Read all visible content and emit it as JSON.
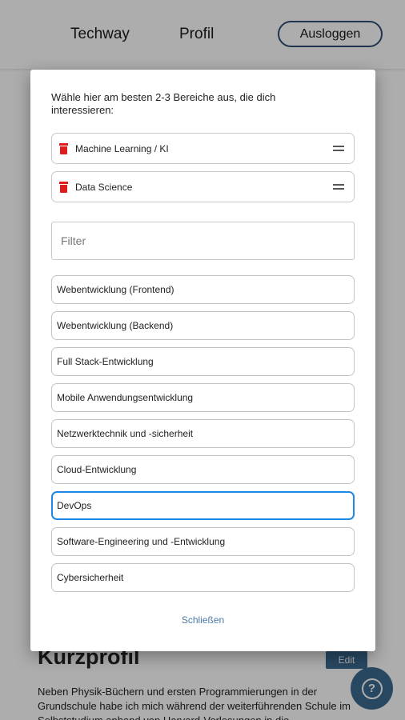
{
  "header": {
    "nav": [
      "Techway",
      "Profil"
    ],
    "logout_label": "Ausloggen"
  },
  "background": {
    "section_title": "Kurzprofil",
    "edit_label": "Edit",
    "bio_text": "Neben Physik-Büchern und ersten Programmierungen in der Grundschule habe ich mich während der weiterführenden Schule im Selbststudium anhand von Harvard-Vorlesungen in die",
    "help_icon": "question-circle-icon"
  },
  "dialog": {
    "intro": "Wähle hier am besten 2-3 Bereiche aus, die dich interessieren:",
    "selected": [
      {
        "label": "Machine Learning / KI"
      },
      {
        "label": "Data Science"
      }
    ],
    "filter_placeholder": "Filter",
    "options": [
      "Webentwicklung (Frontend)",
      "Webentwicklung (Backend)",
      "Full Stack-Entwicklung",
      "Mobile Anwendungsentwicklung",
      "Netzwerktechnik und -sicherheit",
      "Cloud-Entwicklung",
      "DevOps",
      "Software-Engineering und -Entwicklung",
      "Cybersicherheit"
    ],
    "focused_option": "DevOps",
    "close_label": "Schließen"
  },
  "colors": {
    "accent": "#3b6a91",
    "delete": "#e01b1b",
    "focus": "#1e88e5"
  }
}
